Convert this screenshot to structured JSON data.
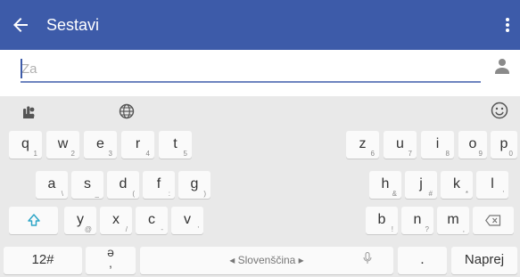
{
  "appbar": {
    "title": "Sestavi",
    "color": "#3d5ba9",
    "back_icon": "arrow-left-icon",
    "menu_icon": "more-vert-icon"
  },
  "compose": {
    "placeholder": "Za",
    "value": "",
    "contact_icon": "person-icon"
  },
  "keyboard": {
    "toolbar": {
      "left_icon": "hand-touch-icon",
      "globe_icon": "globe-icon",
      "emoji_icon": "smiley-icon"
    },
    "row1": [
      {
        "label": "q",
        "sub": "1"
      },
      {
        "label": "w",
        "sub": "2"
      },
      {
        "label": "e",
        "sub": "3"
      },
      {
        "label": "r",
        "sub": "4"
      },
      {
        "label": "t",
        "sub": "5"
      },
      {
        "label": "z",
        "sub": "6"
      },
      {
        "label": "u",
        "sub": "7"
      },
      {
        "label": "i",
        "sub": "8"
      },
      {
        "label": "o",
        "sub": "9"
      },
      {
        "label": "p",
        "sub": "0"
      }
    ],
    "row2": [
      {
        "label": "a",
        "sub": "\\"
      },
      {
        "label": "s",
        "sub": "_"
      },
      {
        "label": "d",
        "sub": "("
      },
      {
        "label": "f",
        "sub": ":"
      },
      {
        "label": "g",
        "sub": ")"
      },
      {
        "label": "h",
        "sub": "&"
      },
      {
        "label": "j",
        "sub": "#"
      },
      {
        "label": "k",
        "sub": "*"
      },
      {
        "label": "l",
        "sub": "'"
      }
    ],
    "row3": [
      {
        "label": "y",
        "sub": "@"
      },
      {
        "label": "x",
        "sub": "/"
      },
      {
        "label": "c",
        "sub": "-"
      },
      {
        "label": "v",
        "sub": "'"
      },
      {
        "label": "b",
        "sub": "!"
      },
      {
        "label": "n",
        "sub": "?"
      },
      {
        "label": "m",
        "sub": ","
      }
    ],
    "shift_icon": "shift-arrow-icon",
    "backspace_icon": "backspace-icon",
    "bottom": {
      "symbols": "12#",
      "punct_top": "ə",
      "punct_bottom": ",",
      "space": "◂ Slovenščina ▸",
      "period": ".",
      "enter": "Naprej",
      "mic_icon": "mic-icon"
    }
  }
}
